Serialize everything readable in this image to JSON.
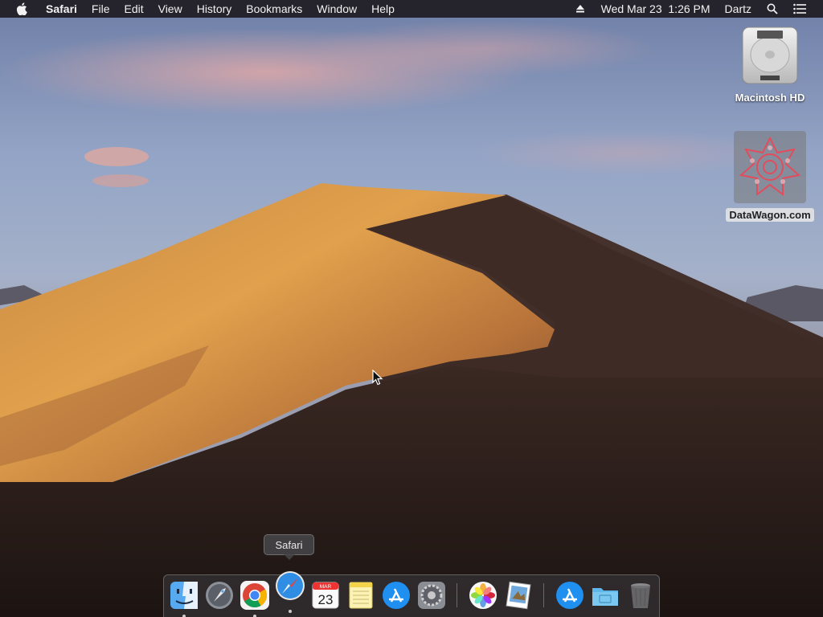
{
  "menubar": {
    "app_name": "Safari",
    "menus": [
      "File",
      "Edit",
      "View",
      "History",
      "Bookmarks",
      "Window",
      "Help"
    ],
    "datetime": "Wed Mar 23  1:26 PM",
    "user": "Dartz",
    "icons": [
      "apple-icon",
      "eject-icon",
      "spotlight-search-icon",
      "notification-center-icon"
    ]
  },
  "desktop": {
    "wallpaper": "macOS Mojave Day",
    "icons": [
      {
        "label": "Macintosh HD"
      },
      {
        "label": "DataWagon.com"
      }
    ]
  },
  "dock": {
    "tooltip": "Safari",
    "items": [
      {
        "name": "finder",
        "running": true
      },
      {
        "name": "launchpad",
        "running": false
      },
      {
        "name": "google-chrome",
        "running": true
      },
      {
        "name": "safari",
        "running": true
      },
      {
        "name": "calendar",
        "month": "MAR",
        "day": "23",
        "running": false
      },
      {
        "name": "notes",
        "running": false
      },
      {
        "name": "app-store",
        "running": false
      },
      {
        "name": "system-preferences",
        "running": false
      },
      {
        "name": "photos",
        "running": false
      },
      {
        "name": "preview",
        "running": false
      },
      {
        "name": "app-store-downloads",
        "running": false
      },
      {
        "name": "documents-folder",
        "running": false
      },
      {
        "name": "trash",
        "running": false
      }
    ]
  },
  "colors": {
    "menubar_bg": "#1e1c22",
    "dune_light": "#d9963e",
    "dune_dark": "#3a2620",
    "sky": "#8ea0c4"
  }
}
